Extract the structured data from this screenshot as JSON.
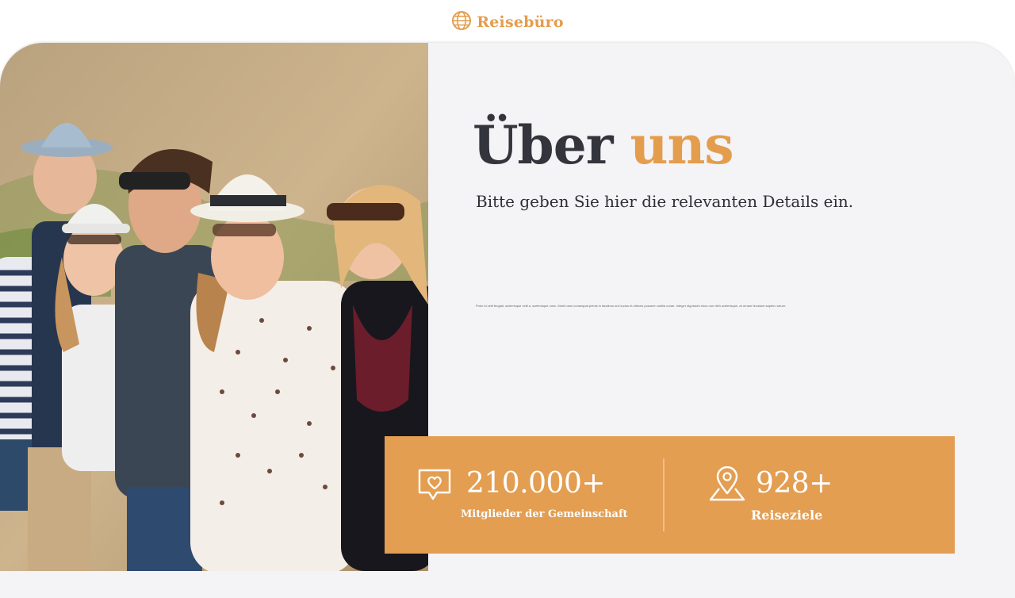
{
  "brand": {
    "name": "Reisebüro",
    "icon": "globe-icon",
    "color": "#e39d4d"
  },
  "about": {
    "title_main": "Über",
    "title_accent": "uns",
    "subtitle": "Bitte geben Sie hier die relevanten Details ein.",
    "body": "Proin id velit feugiat, scelerisque velit a, scelerisque nunc. Morbi dum consequat primis in faucibus orci luctus et ultrices posuere cubilia curae. Integer dignissim risus non nibh scelerisque, at ornare tincidunt sapien rutrum."
  },
  "stats": [
    {
      "value": "210.000+",
      "label": "Mitglieder der Gemeinschaft",
      "icon": "heart-chat-icon"
    },
    {
      "value": "928+",
      "label": "Reiseziele",
      "icon": "map-pin-icon"
    }
  ],
  "colors": {
    "accent": "#e39d4d",
    "stats_bg": "#e39e52",
    "card_bg": "#f4f3f6",
    "heading": "#34343c"
  },
  "photo": {
    "subject": "group-of-travelers-photo"
  }
}
